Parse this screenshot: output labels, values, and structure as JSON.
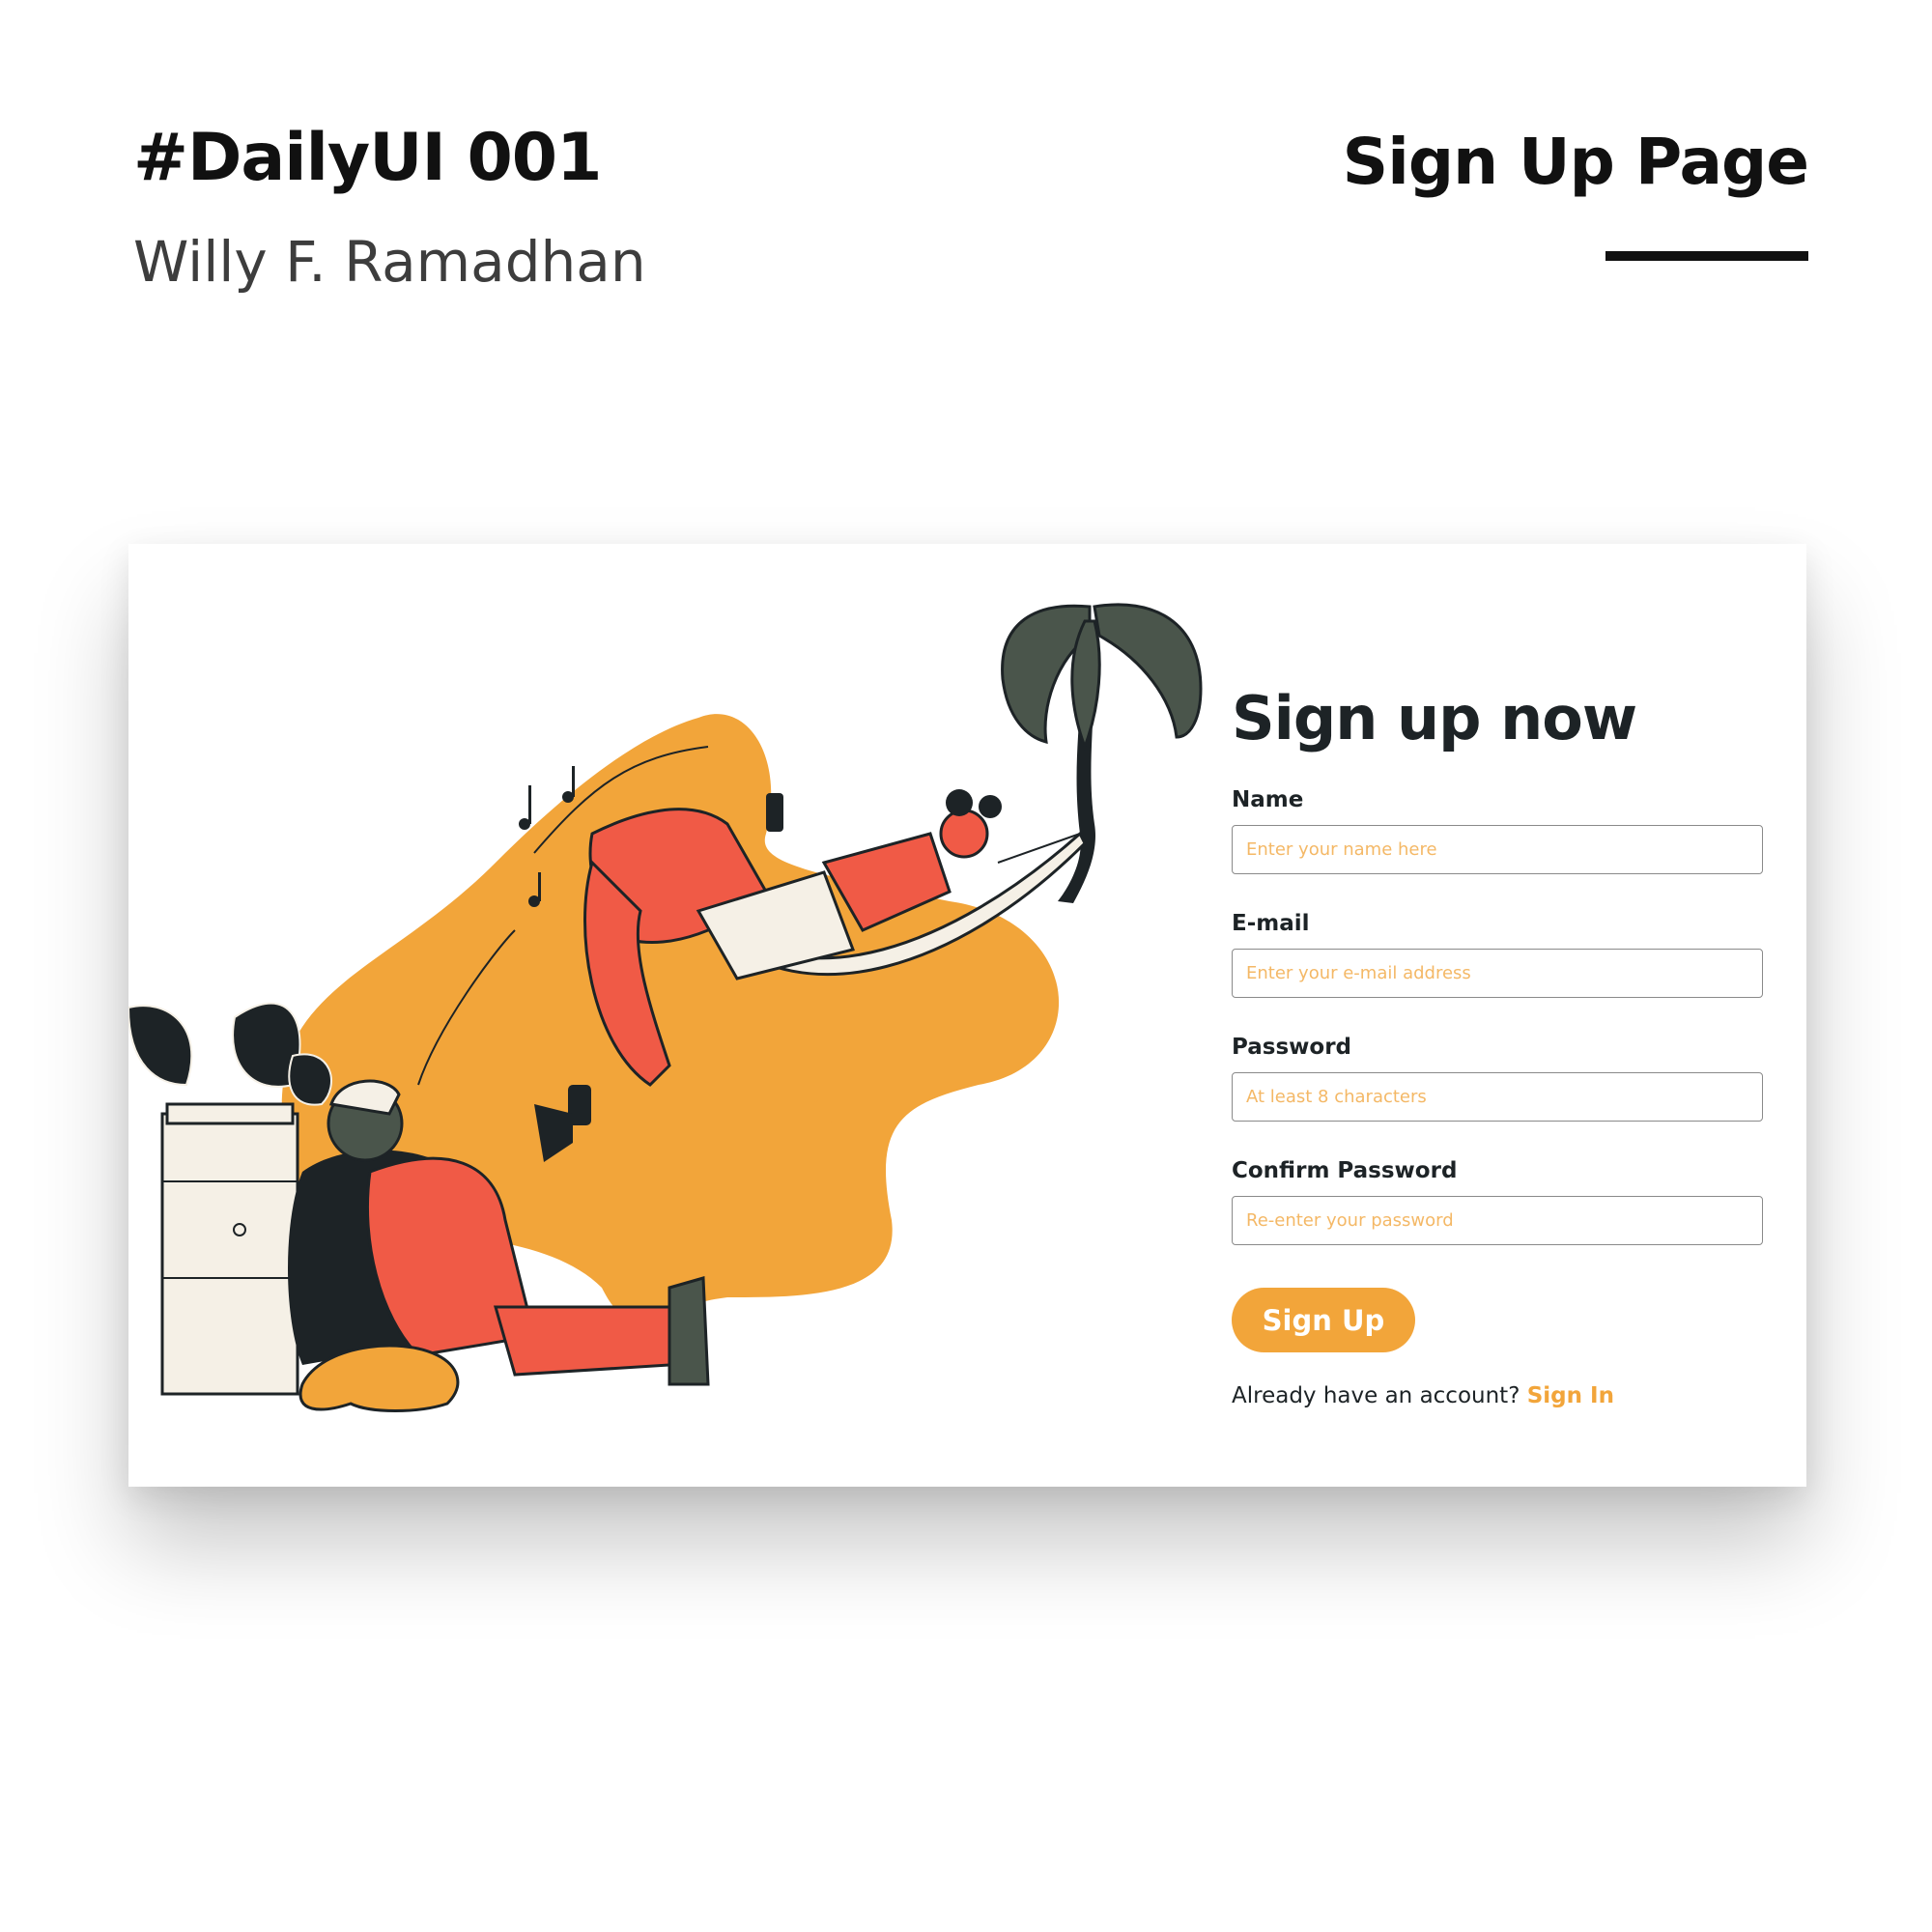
{
  "header": {
    "title": "#DailyUI 001",
    "author": "Willy F. Ramadhan",
    "page_name": "Sign Up Page"
  },
  "colors": {
    "accent": "#f2a53a",
    "dark": "#1d2326",
    "coral": "#f05a46"
  },
  "form": {
    "heading": "Sign up now",
    "fields": [
      {
        "label": "Name",
        "placeholder": "Enter your name here"
      },
      {
        "label": "E-mail",
        "placeholder": "Enter your e-mail address"
      },
      {
        "label": "Password",
        "placeholder": "At least 8 characters"
      },
      {
        "label": "Confirm Password",
        "placeholder": "Re-enter your password"
      }
    ],
    "submit_label": "Sign Up",
    "footer_text": "Already have an account?",
    "footer_link": "Sign In"
  }
}
